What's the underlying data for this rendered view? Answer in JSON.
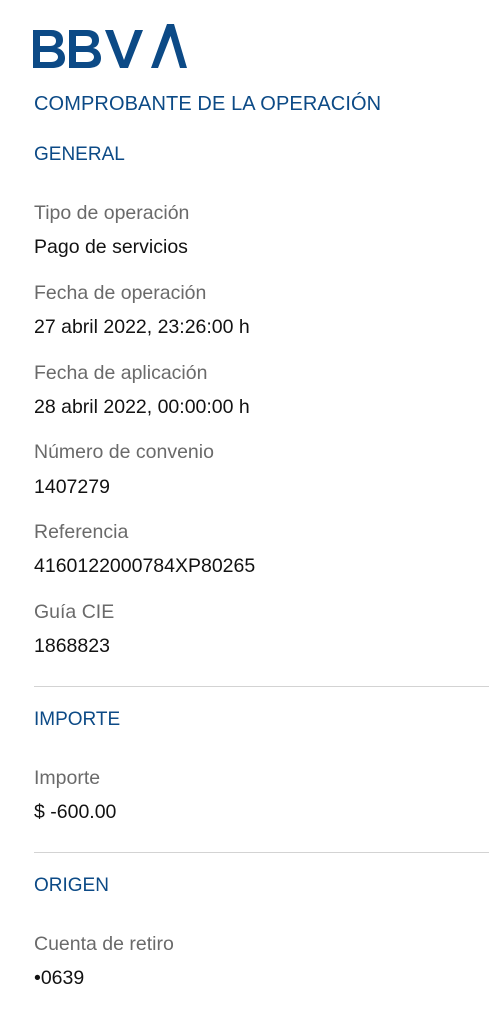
{
  "brand": {
    "logo_text": "BBVA",
    "color": "#0c4a86"
  },
  "doc_title": "COMPROBANTE DE LA OPERACIÓN",
  "general": {
    "title": "GENERAL",
    "fields": [
      {
        "label": "Tipo de operación",
        "value": "Pago de servicios"
      },
      {
        "label": "Fecha de operación",
        "value": "27 abril 2022, 23:26:00 h"
      },
      {
        "label": "Fecha de aplicación",
        "value": "28 abril 2022, 00:00:00 h"
      },
      {
        "label": "Número de convenio",
        "value": "1407279"
      },
      {
        "label": "Referencia",
        "value": "4160122000784XP80265"
      },
      {
        "label": "Guía CIE",
        "value": "1868823"
      }
    ]
  },
  "importe": {
    "title": "IMPORTE",
    "fields": [
      {
        "label": "Importe",
        "value": "$ -600.00"
      }
    ]
  },
  "origen": {
    "title": "ORIGEN",
    "fields": [
      {
        "label": "Cuenta de retiro",
        "value": "•0639"
      }
    ]
  }
}
